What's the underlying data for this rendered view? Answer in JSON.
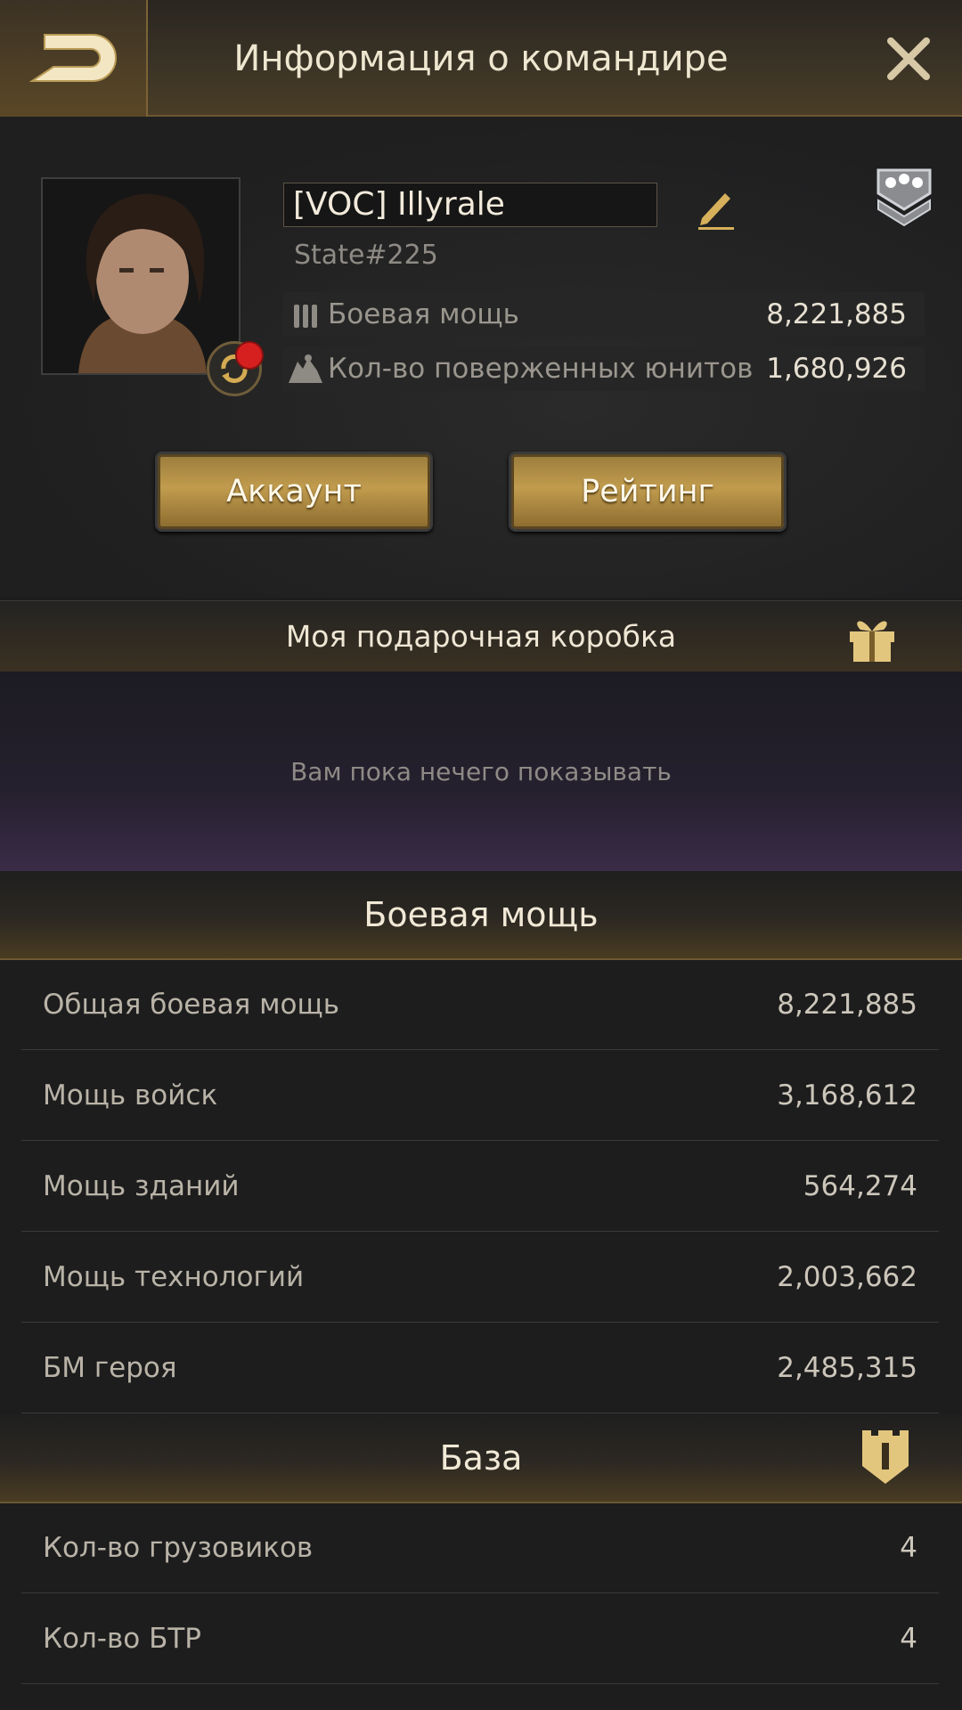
{
  "header": {
    "title": "Информация о командире"
  },
  "profile": {
    "name": "[VOC] Illyrale",
    "state": "State#225",
    "stats": [
      {
        "icon": "ammo-icon",
        "label": "Боевая мощь",
        "value": "8,221,885"
      },
      {
        "icon": "kills-icon",
        "label": "Кол-во поверженных юнитов",
        "value": "1,680,926"
      }
    ],
    "buttons": {
      "account": "Аккаунт",
      "rating": "Рейтинг"
    }
  },
  "gift_box": {
    "title": "Моя подарочная коробка",
    "empty_text": "Вам пока нечего показывать"
  },
  "power": {
    "title": "Боевая мощь",
    "rows": [
      {
        "label": "Общая боевая мощь",
        "value": "8,221,885"
      },
      {
        "label": "Мощь войск",
        "value": "3,168,612"
      },
      {
        "label": "Мощь зданий",
        "value": "564,274"
      },
      {
        "label": "Мощь технологий",
        "value": "2,003,662"
      },
      {
        "label": "БМ героя",
        "value": "2,485,315"
      }
    ]
  },
  "base": {
    "title": "База",
    "rows": [
      {
        "label": "Кол-во грузовиков",
        "value": "4"
      },
      {
        "label": "Кол-во БТР",
        "value": "4"
      }
    ]
  },
  "colors": {
    "gold": "#c19c4e",
    "background": "#1d1d1e",
    "notification": "#d62020"
  }
}
